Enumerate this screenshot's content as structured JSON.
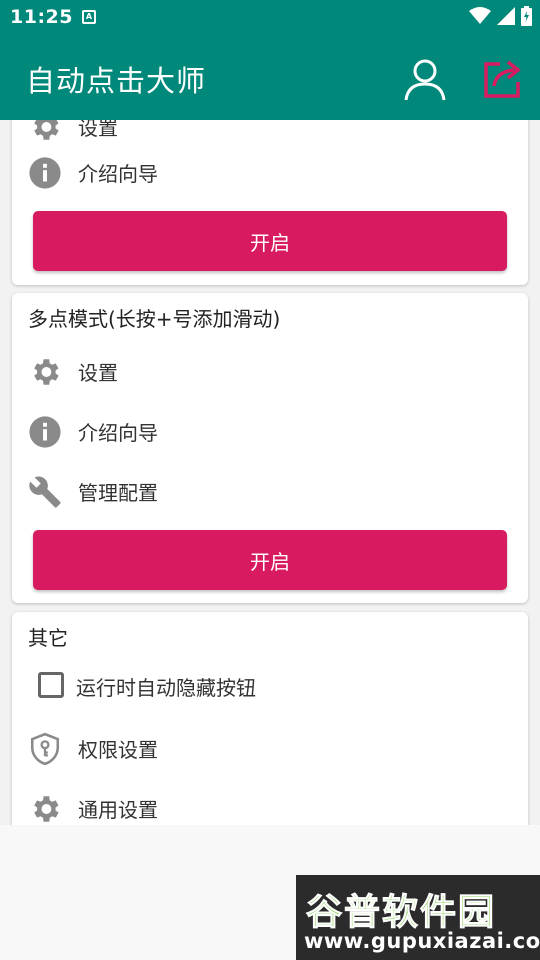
{
  "status_bar": {
    "time": "11:25",
    "notif_icon": "A"
  },
  "app_bar": {
    "title": "自动点击大师",
    "user_icon": "person-icon",
    "share_icon": "share-icon"
  },
  "colors": {
    "primary": "#00897b",
    "accent": "#d81b60",
    "icon_gray": "#8a8a8a"
  },
  "card1": {
    "partial_label": "设置",
    "items": [
      {
        "label": "介绍向导",
        "icon": "info-icon"
      }
    ],
    "start_label": "开启"
  },
  "card2": {
    "title": "多点模式(长按+号添加滑动)",
    "items": [
      {
        "label": "设置",
        "icon": "gear-icon"
      },
      {
        "label": "介绍向导",
        "icon": "info-icon"
      },
      {
        "label": "管理配置",
        "icon": "wrench-icon"
      }
    ],
    "start_label": "开启"
  },
  "card3": {
    "title": "其它",
    "checkbox": {
      "label": "运行时自动隐藏按钮",
      "checked": false
    },
    "items": [
      {
        "label": "权限设置",
        "icon": "shield-key-icon"
      },
      {
        "label": "通用设置",
        "icon": "gear-icon"
      }
    ]
  },
  "watermark": {
    "title": "谷普软件园",
    "url": "www.gupuxiazai.com"
  }
}
